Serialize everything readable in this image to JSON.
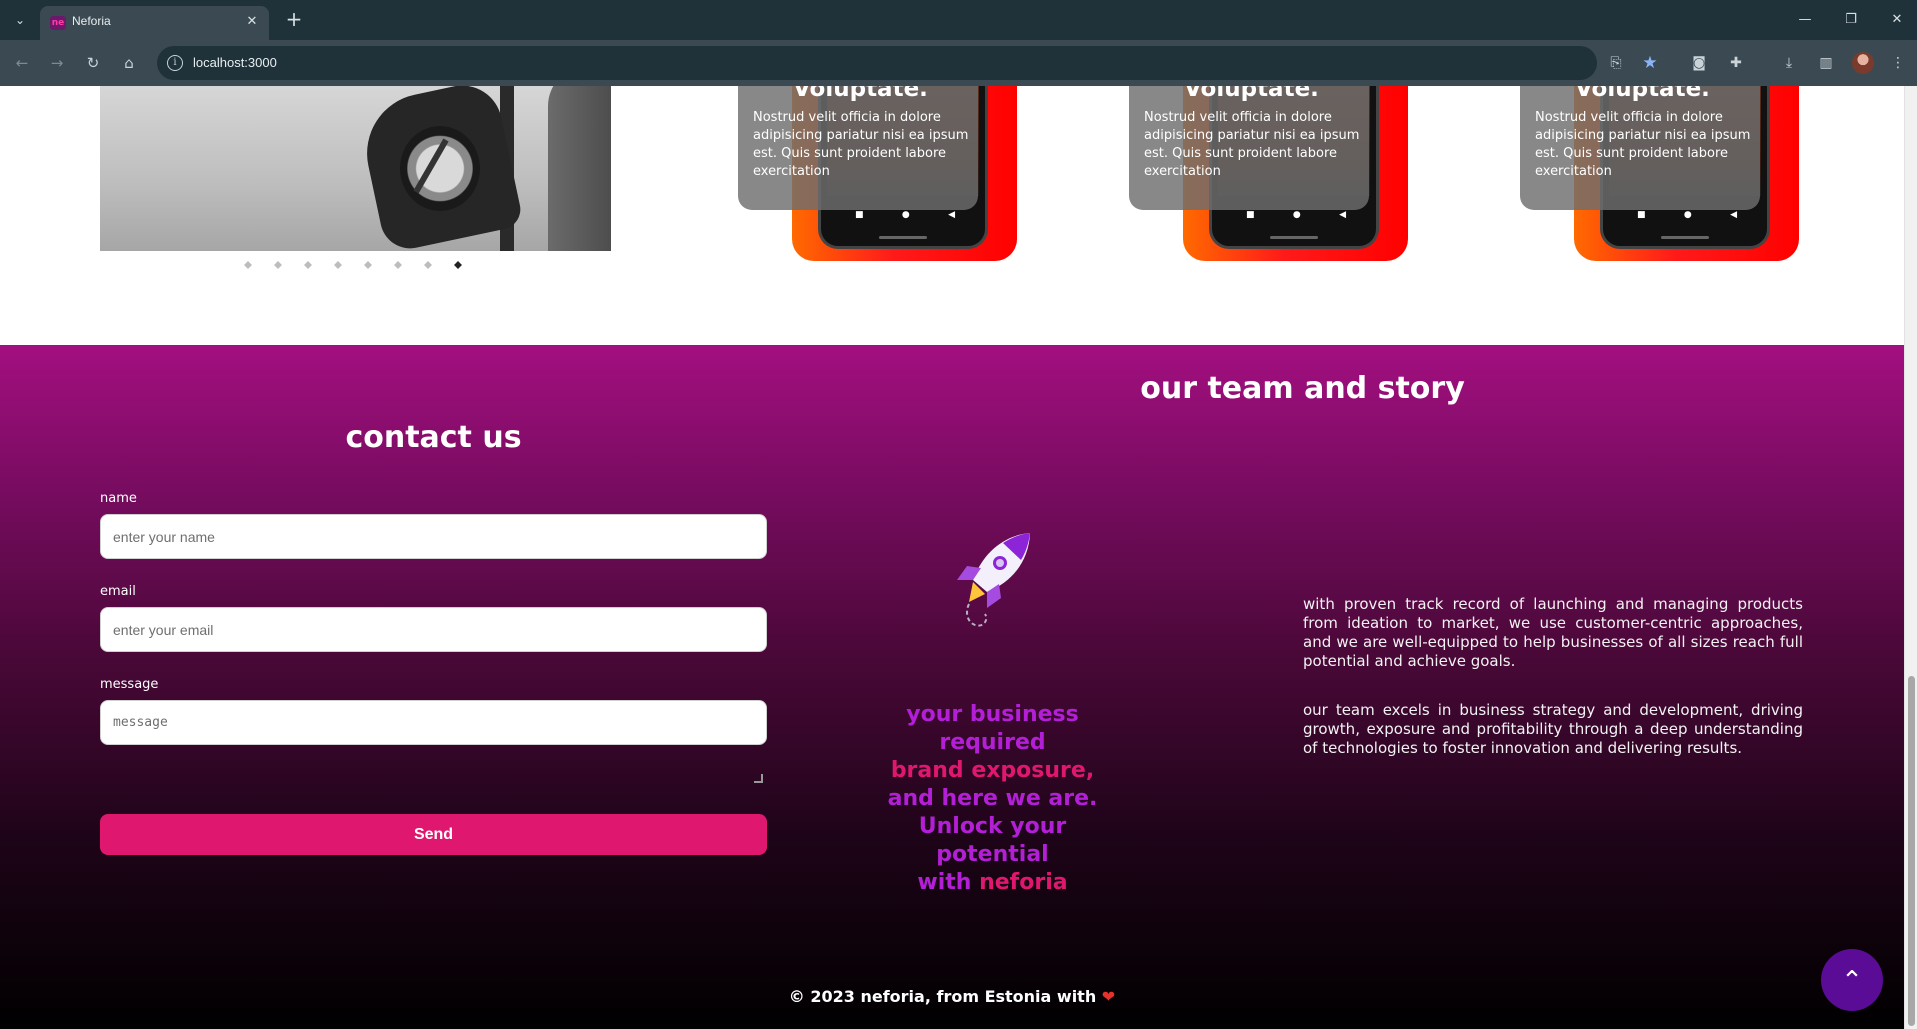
{
  "browser": {
    "tab_title": "Neforia",
    "favicon_text": "ne",
    "new_tab_symbol": "+",
    "url": "localhost:3000"
  },
  "icons": {
    "tab_list": "chevron-down-icon",
    "close_tab": "close-icon",
    "minimize": "minimize-icon",
    "restore": "restore-icon",
    "close_window": "close-icon",
    "back": "arrow-left-icon",
    "forward": "arrow-right-icon",
    "reload": "reload-icon",
    "home": "home-icon",
    "site_info": "info-icon",
    "install": "install-app-icon",
    "bookmark": "star-icon",
    "screenshot": "camera-icon",
    "extensions": "puzzle-icon",
    "downloads": "download-icon",
    "side_panel": "side-panel-icon",
    "menu": "more-vertical-icon",
    "scroll_top": "chevron-up-icon"
  },
  "carousel": {
    "dots_count": 8,
    "active_dot": 8
  },
  "cards": [
    {
      "title": "Voluptate.",
      "text": "Nostrud velit officia in dolore adipisicing pariatur nisi ea ipsum est. Quis sunt proident labore exercitation"
    },
    {
      "title": "Voluptate.",
      "text": "Nostrud velit officia in dolore adipisicing pariatur nisi ea ipsum est. Quis sunt proident labore exercitation"
    },
    {
      "title": "Voluptate.",
      "text": "Nostrud velit officia in dolore adipisicing pariatur nisi ea ipsum est. Quis sunt proident labore exercitation"
    }
  ],
  "contact": {
    "title": "contact us",
    "name_label": "name",
    "name_placeholder": "enter your name",
    "email_label": "email",
    "email_placeholder": "enter your email",
    "message_label": "message",
    "message_placeholder": "message",
    "send_label": "Send"
  },
  "slogan": {
    "line1": "your business",
    "line2": "required",
    "line3": "brand exposure,",
    "line4": "and here we are.",
    "line5": "Unlock your",
    "line6": "potential",
    "line7_prefix": "with ",
    "line7_brand": "neforia"
  },
  "team": {
    "title": "our team and story",
    "paragraph1": "with proven track record of launching and managing products from ideation to market, we use customer-centric approaches, and we are well-equipped to help businesses of all sizes reach full potential and achieve goals.",
    "paragraph2": "our team excels in business strategy and development, driving growth, exposure and profitability through a deep understanding of technologies to foster innovation and delivering results."
  },
  "footer": {
    "text": "© 2023 neforia, from Estonia with",
    "heart": "❤"
  },
  "colors": {
    "accent_pink": "#e0176f",
    "accent_purple": "#b31fd6",
    "scroll_button": "#5a0c96",
    "gradient_top": "#a30f80"
  }
}
